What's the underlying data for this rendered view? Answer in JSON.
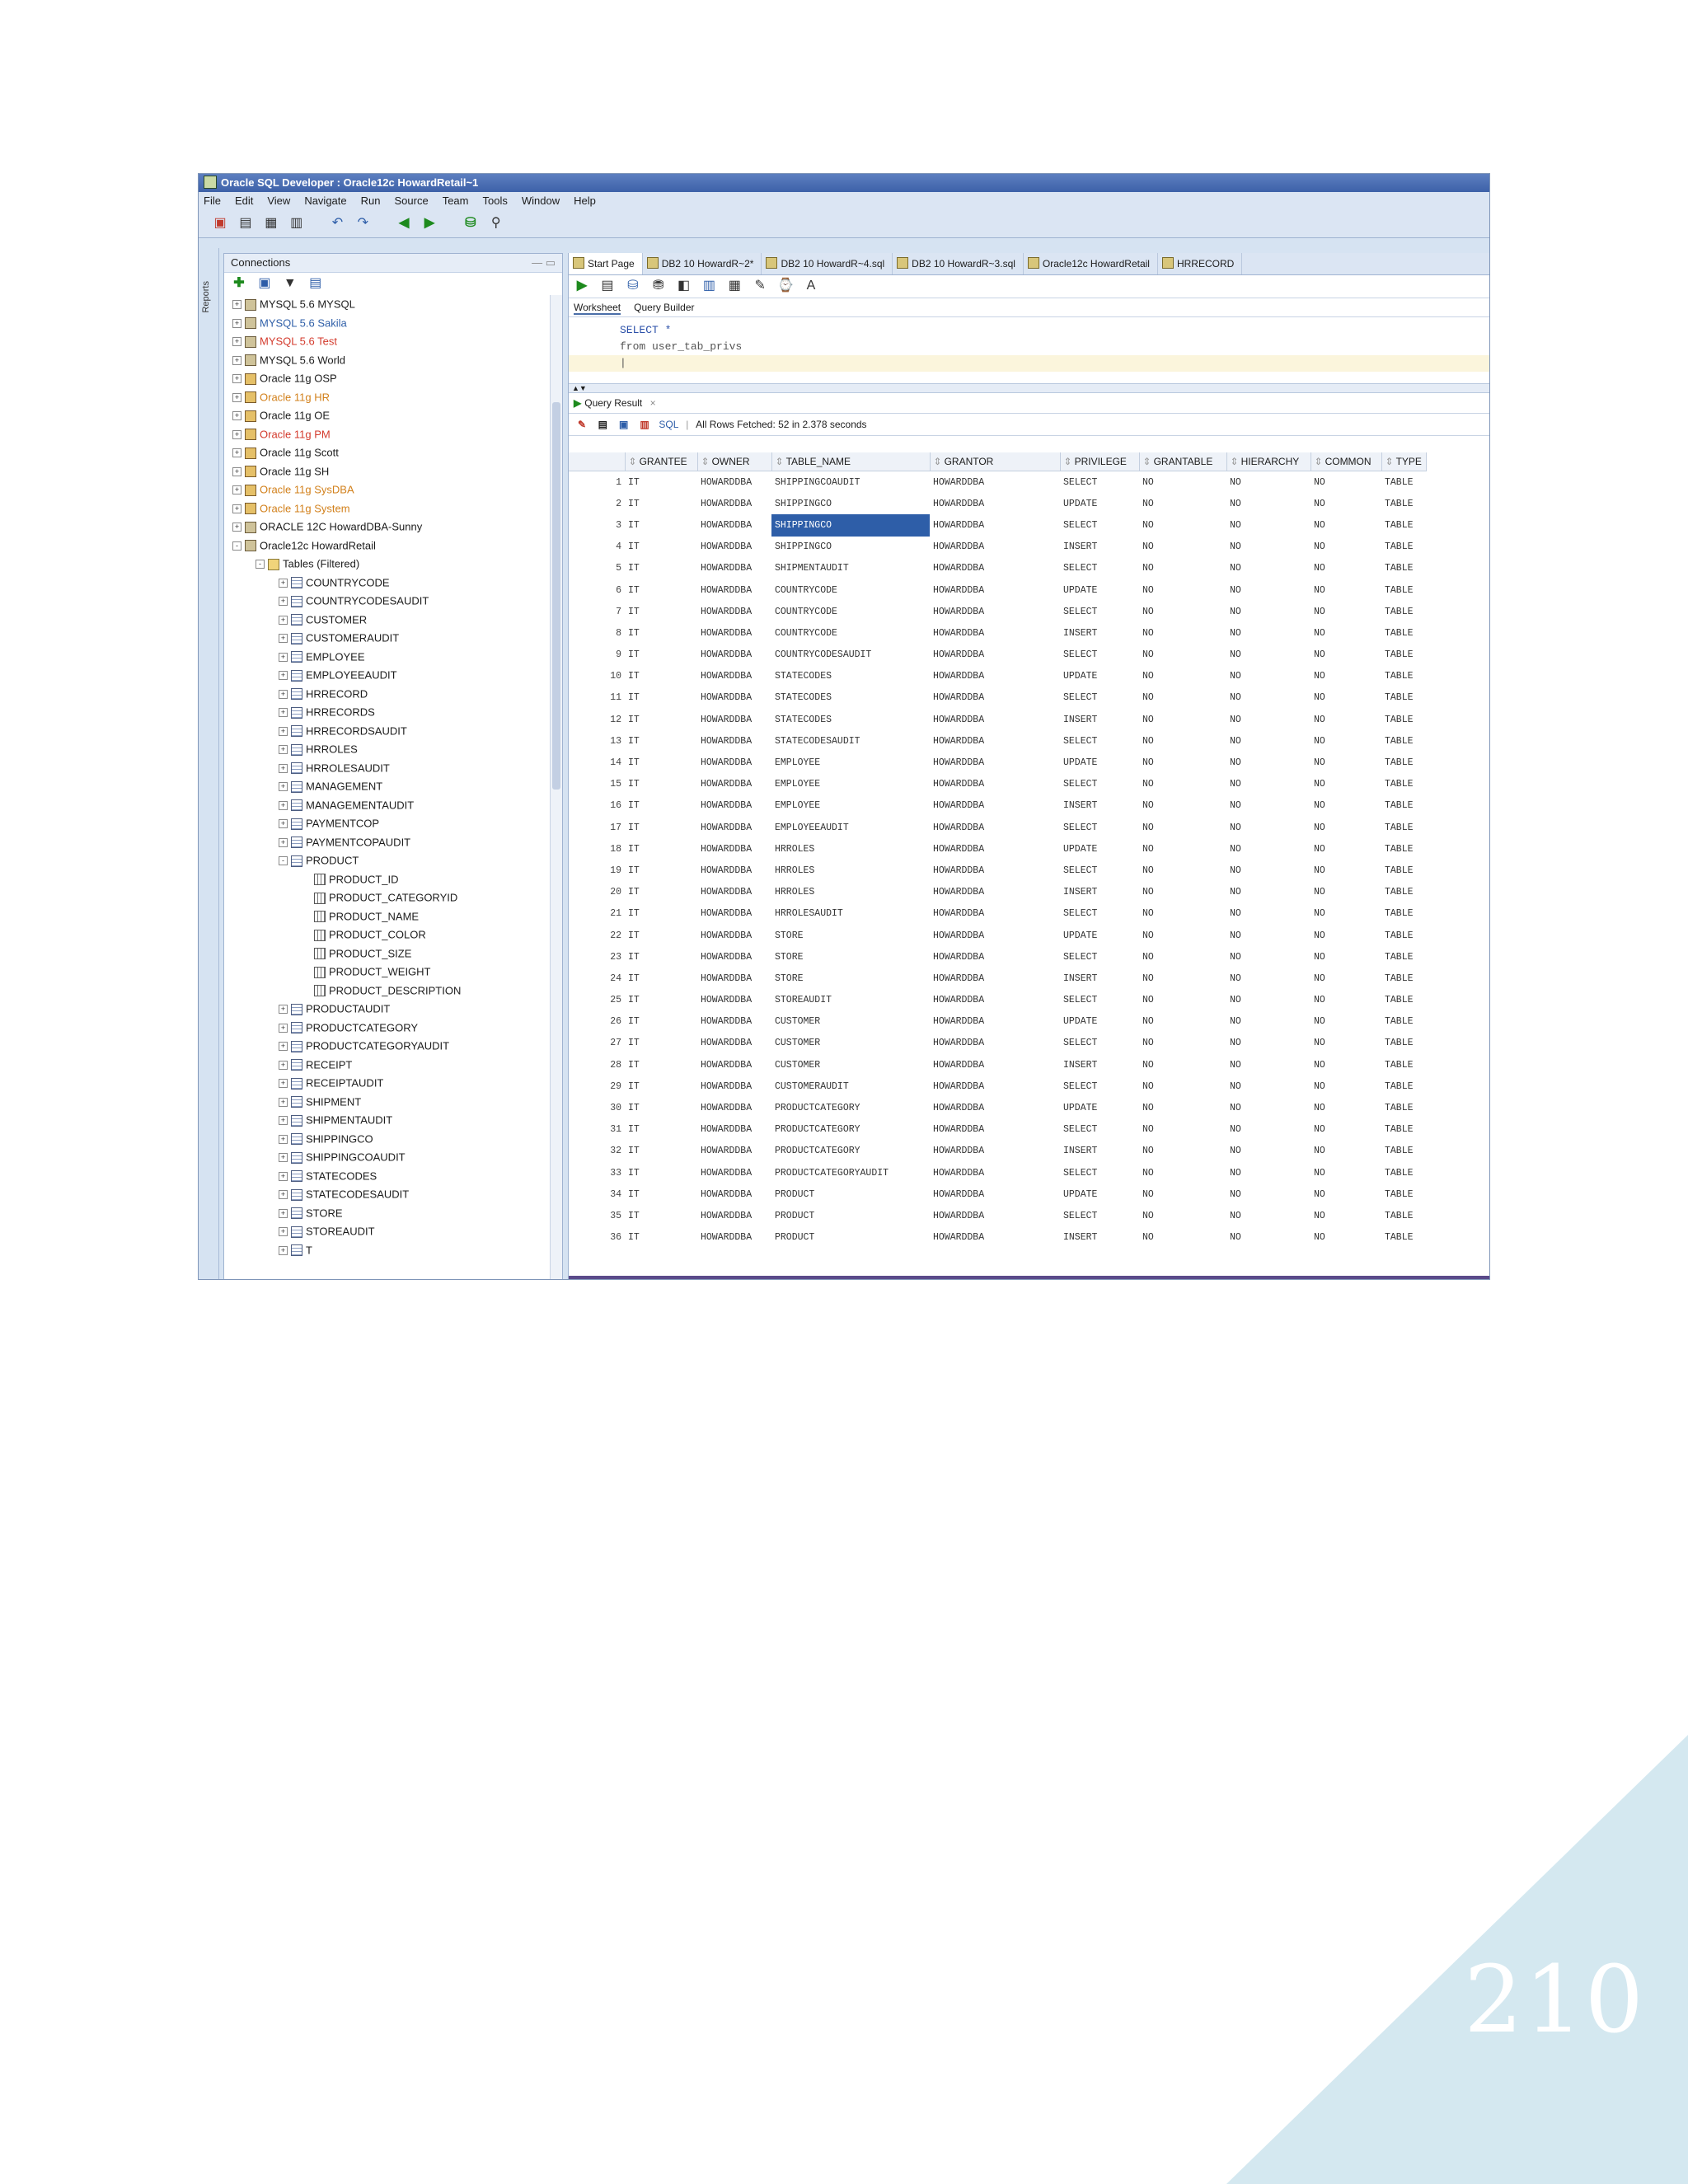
{
  "window": {
    "title": "Oracle SQL Developer : Oracle12c HowardRetail~1"
  },
  "menu": [
    "File",
    "Edit",
    "View",
    "Navigate",
    "Run",
    "Source",
    "Team",
    "Tools",
    "Window",
    "Help"
  ],
  "side_strip": {
    "label": "Reports"
  },
  "connections": {
    "title": "Connections",
    "items": [
      {
        "expander": "+",
        "icon": "conn",
        "label": "MYSQL 5.6 MYSQL",
        "indent": 0,
        "color": ""
      },
      {
        "expander": "+",
        "icon": "conn",
        "label": "MYSQL 5.6 Sakila",
        "indent": 0,
        "color": "blue"
      },
      {
        "expander": "+",
        "icon": "conn",
        "label": "MYSQL 5.6 Test",
        "indent": 0,
        "color": "red"
      },
      {
        "expander": "+",
        "icon": "conn",
        "label": "MYSQL 5.6 World",
        "indent": 0,
        "color": ""
      },
      {
        "expander": "+",
        "icon": "oconn",
        "label": "Oracle 11g OSP",
        "indent": 0,
        "color": ""
      },
      {
        "expander": "+",
        "icon": "oconn",
        "label": "Oracle 11g HR",
        "indent": 0,
        "color": "orange"
      },
      {
        "expander": "+",
        "icon": "oconn",
        "label": "Oracle 11g OE",
        "indent": 0,
        "color": ""
      },
      {
        "expander": "+",
        "icon": "oconn",
        "label": "Oracle 11g PM",
        "indent": 0,
        "color": "red"
      },
      {
        "expander": "+",
        "icon": "oconn",
        "label": "Oracle 11g Scott",
        "indent": 0,
        "color": ""
      },
      {
        "expander": "+",
        "icon": "oconn",
        "label": "Oracle 11g SH",
        "indent": 0,
        "color": ""
      },
      {
        "expander": "+",
        "icon": "oconn",
        "label": "Oracle 11g SysDBA",
        "indent": 0,
        "color": "orange"
      },
      {
        "expander": "+",
        "icon": "oconn",
        "label": "Oracle 11g System",
        "indent": 0,
        "color": "orange"
      },
      {
        "expander": "+",
        "icon": "conn",
        "label": "ORACLE 12C HowardDBA-Sunny",
        "indent": 0,
        "color": ""
      },
      {
        "expander": "-",
        "icon": "conn",
        "label": "Oracle12c HowardRetail",
        "indent": 0,
        "color": ""
      },
      {
        "expander": "-",
        "icon": "folder",
        "label": "Tables (Filtered)",
        "indent": 1,
        "color": ""
      },
      {
        "expander": "+",
        "icon": "table",
        "label": "COUNTRYCODE",
        "indent": 2,
        "color": ""
      },
      {
        "expander": "+",
        "icon": "table",
        "label": "COUNTRYCODESAUDIT",
        "indent": 2,
        "color": ""
      },
      {
        "expander": "+",
        "icon": "table",
        "label": "CUSTOMER",
        "indent": 2,
        "color": ""
      },
      {
        "expander": "+",
        "icon": "table",
        "label": "CUSTOMERAUDIT",
        "indent": 2,
        "color": ""
      },
      {
        "expander": "+",
        "icon": "table",
        "label": "EMPLOYEE",
        "indent": 2,
        "color": ""
      },
      {
        "expander": "+",
        "icon": "table",
        "label": "EMPLOYEEAUDIT",
        "indent": 2,
        "color": ""
      },
      {
        "expander": "+",
        "icon": "table",
        "label": "HRRECORD",
        "indent": 2,
        "color": ""
      },
      {
        "expander": "+",
        "icon": "table",
        "label": "HRRECORDS",
        "indent": 2,
        "color": ""
      },
      {
        "expander": "+",
        "icon": "table",
        "label": "HRRECORDSAUDIT",
        "indent": 2,
        "color": ""
      },
      {
        "expander": "+",
        "icon": "table",
        "label": "HRROLES",
        "indent": 2,
        "color": ""
      },
      {
        "expander": "+",
        "icon": "table",
        "label": "HRROLESAUDIT",
        "indent": 2,
        "color": ""
      },
      {
        "expander": "+",
        "icon": "table",
        "label": "MANAGEMENT",
        "indent": 2,
        "color": ""
      },
      {
        "expander": "+",
        "icon": "table",
        "label": "MANAGEMENTAUDIT",
        "indent": 2,
        "color": ""
      },
      {
        "expander": "+",
        "icon": "table",
        "label": "PAYMENTCOP",
        "indent": 2,
        "color": ""
      },
      {
        "expander": "+",
        "icon": "table",
        "label": "PAYMENTCOPAUDIT",
        "indent": 2,
        "color": ""
      },
      {
        "expander": "-",
        "icon": "table",
        "label": "PRODUCT",
        "indent": 2,
        "color": ""
      },
      {
        "expander": "",
        "icon": "column",
        "label": "PRODUCT_ID",
        "indent": 3,
        "color": ""
      },
      {
        "expander": "",
        "icon": "column",
        "label": "PRODUCT_CATEGORYID",
        "indent": 3,
        "color": ""
      },
      {
        "expander": "",
        "icon": "column",
        "label": "PRODUCT_NAME",
        "indent": 3,
        "color": ""
      },
      {
        "expander": "",
        "icon": "column",
        "label": "PRODUCT_COLOR",
        "indent": 3,
        "color": ""
      },
      {
        "expander": "",
        "icon": "column",
        "label": "PRODUCT_SIZE",
        "indent": 3,
        "color": ""
      },
      {
        "expander": "",
        "icon": "column",
        "label": "PRODUCT_WEIGHT",
        "indent": 3,
        "color": ""
      },
      {
        "expander": "",
        "icon": "column",
        "label": "PRODUCT_DESCRIPTION",
        "indent": 3,
        "color": ""
      },
      {
        "expander": "+",
        "icon": "table",
        "label": "PRODUCTAUDIT",
        "indent": 2,
        "color": ""
      },
      {
        "expander": "+",
        "icon": "table",
        "label": "PRODUCTCATEGORY",
        "indent": 2,
        "color": ""
      },
      {
        "expander": "+",
        "icon": "table",
        "label": "PRODUCTCATEGORYAUDIT",
        "indent": 2,
        "color": ""
      },
      {
        "expander": "+",
        "icon": "table",
        "label": "RECEIPT",
        "indent": 2,
        "color": ""
      },
      {
        "expander": "+",
        "icon": "table",
        "label": "RECEIPTAUDIT",
        "indent": 2,
        "color": ""
      },
      {
        "expander": "+",
        "icon": "table",
        "label": "SHIPMENT",
        "indent": 2,
        "color": ""
      },
      {
        "expander": "+",
        "icon": "table",
        "label": "SHIPMENTAUDIT",
        "indent": 2,
        "color": ""
      },
      {
        "expander": "+",
        "icon": "table",
        "label": "SHIPPINGCO",
        "indent": 2,
        "color": ""
      },
      {
        "expander": "+",
        "icon": "table",
        "label": "SHIPPINGCOAUDIT",
        "indent": 2,
        "color": ""
      },
      {
        "expander": "+",
        "icon": "table",
        "label": "STATECODES",
        "indent": 2,
        "color": ""
      },
      {
        "expander": "+",
        "icon": "table",
        "label": "STATECODESAUDIT",
        "indent": 2,
        "color": ""
      },
      {
        "expander": "+",
        "icon": "table",
        "label": "STORE",
        "indent": 2,
        "color": ""
      },
      {
        "expander": "+",
        "icon": "table",
        "label": "STOREAUDIT",
        "indent": 2,
        "color": ""
      },
      {
        "expander": "+",
        "icon": "table",
        "label": "T",
        "indent": 2,
        "color": ""
      }
    ]
  },
  "doc_tabs": [
    "Start Page",
    "DB2 10 HowardR~2*",
    "DB2 10 HowardR~4.sql",
    "DB2 10 HowardR~3.sql",
    "Oracle12c HowardRetail",
    "HRRECORD"
  ],
  "sub_tabs": [
    "Worksheet",
    "Query Builder"
  ],
  "sql": [
    "SELECT *",
    "from user_tab_privs"
  ],
  "result": {
    "tab_label": "Query Result",
    "tab_close": "×",
    "sql_label": "SQL",
    "status": "All Rows Fetched: 52 in 2.378 seconds"
  },
  "grid": {
    "columns": [
      "GRANTEE",
      "OWNER",
      "TABLE_NAME",
      "GRANTOR",
      "PRIVILEGE",
      "GRANTABLE",
      "HIERARCHY",
      "COMMON",
      "TYPE"
    ],
    "rows": [
      [
        "1",
        "IT",
        "HOWARDDBA",
        "SHIPPINGCOAUDIT",
        "HOWARDDBA",
        "SELECT",
        "NO",
        "NO",
        "NO",
        "TABLE"
      ],
      [
        "2",
        "IT",
        "HOWARDDBA",
        "SHIPPINGCO",
        "HOWARDDBA",
        "UPDATE",
        "NO",
        "NO",
        "NO",
        "TABLE"
      ],
      [
        "3",
        "IT",
        "HOWARDDBA",
        "SHIPPINGCO",
        "HOWARDDBA",
        "SELECT",
        "NO",
        "NO",
        "NO",
        "TABLE"
      ],
      [
        "4",
        "IT",
        "HOWARDDBA",
        "SHIPPINGCO",
        "HOWARDDBA",
        "INSERT",
        "NO",
        "NO",
        "NO",
        "TABLE"
      ],
      [
        "5",
        "IT",
        "HOWARDDBA",
        "SHIPMENTAUDIT",
        "HOWARDDBA",
        "SELECT",
        "NO",
        "NO",
        "NO",
        "TABLE"
      ],
      [
        "6",
        "IT",
        "HOWARDDBA",
        "COUNTRYCODE",
        "HOWARDDBA",
        "UPDATE",
        "NO",
        "NO",
        "NO",
        "TABLE"
      ],
      [
        "7",
        "IT",
        "HOWARDDBA",
        "COUNTRYCODE",
        "HOWARDDBA",
        "SELECT",
        "NO",
        "NO",
        "NO",
        "TABLE"
      ],
      [
        "8",
        "IT",
        "HOWARDDBA",
        "COUNTRYCODE",
        "HOWARDDBA",
        "INSERT",
        "NO",
        "NO",
        "NO",
        "TABLE"
      ],
      [
        "9",
        "IT",
        "HOWARDDBA",
        "COUNTRYCODESAUDIT",
        "HOWARDDBA",
        "SELECT",
        "NO",
        "NO",
        "NO",
        "TABLE"
      ],
      [
        "10",
        "IT",
        "HOWARDDBA",
        "STATECODES",
        "HOWARDDBA",
        "UPDATE",
        "NO",
        "NO",
        "NO",
        "TABLE"
      ],
      [
        "11",
        "IT",
        "HOWARDDBA",
        "STATECODES",
        "HOWARDDBA",
        "SELECT",
        "NO",
        "NO",
        "NO",
        "TABLE"
      ],
      [
        "12",
        "IT",
        "HOWARDDBA",
        "STATECODES",
        "HOWARDDBA",
        "INSERT",
        "NO",
        "NO",
        "NO",
        "TABLE"
      ],
      [
        "13",
        "IT",
        "HOWARDDBA",
        "STATECODESAUDIT",
        "HOWARDDBA",
        "SELECT",
        "NO",
        "NO",
        "NO",
        "TABLE"
      ],
      [
        "14",
        "IT",
        "HOWARDDBA",
        "EMPLOYEE",
        "HOWARDDBA",
        "UPDATE",
        "NO",
        "NO",
        "NO",
        "TABLE"
      ],
      [
        "15",
        "IT",
        "HOWARDDBA",
        "EMPLOYEE",
        "HOWARDDBA",
        "SELECT",
        "NO",
        "NO",
        "NO",
        "TABLE"
      ],
      [
        "16",
        "IT",
        "HOWARDDBA",
        "EMPLOYEE",
        "HOWARDDBA",
        "INSERT",
        "NO",
        "NO",
        "NO",
        "TABLE"
      ],
      [
        "17",
        "IT",
        "HOWARDDBA",
        "EMPLOYEEAUDIT",
        "HOWARDDBA",
        "SELECT",
        "NO",
        "NO",
        "NO",
        "TABLE"
      ],
      [
        "18",
        "IT",
        "HOWARDDBA",
        "HRROLES",
        "HOWARDDBA",
        "UPDATE",
        "NO",
        "NO",
        "NO",
        "TABLE"
      ],
      [
        "19",
        "IT",
        "HOWARDDBA",
        "HRROLES",
        "HOWARDDBA",
        "SELECT",
        "NO",
        "NO",
        "NO",
        "TABLE"
      ],
      [
        "20",
        "IT",
        "HOWARDDBA",
        "HRROLES",
        "HOWARDDBA",
        "INSERT",
        "NO",
        "NO",
        "NO",
        "TABLE"
      ],
      [
        "21",
        "IT",
        "HOWARDDBA",
        "HRROLESAUDIT",
        "HOWARDDBA",
        "SELECT",
        "NO",
        "NO",
        "NO",
        "TABLE"
      ],
      [
        "22",
        "IT",
        "HOWARDDBA",
        "STORE",
        "HOWARDDBA",
        "UPDATE",
        "NO",
        "NO",
        "NO",
        "TABLE"
      ],
      [
        "23",
        "IT",
        "HOWARDDBA",
        "STORE",
        "HOWARDDBA",
        "SELECT",
        "NO",
        "NO",
        "NO",
        "TABLE"
      ],
      [
        "24",
        "IT",
        "HOWARDDBA",
        "STORE",
        "HOWARDDBA",
        "INSERT",
        "NO",
        "NO",
        "NO",
        "TABLE"
      ],
      [
        "25",
        "IT",
        "HOWARDDBA",
        "STOREAUDIT",
        "HOWARDDBA",
        "SELECT",
        "NO",
        "NO",
        "NO",
        "TABLE"
      ],
      [
        "26",
        "IT",
        "HOWARDDBA",
        "CUSTOMER",
        "HOWARDDBA",
        "UPDATE",
        "NO",
        "NO",
        "NO",
        "TABLE"
      ],
      [
        "27",
        "IT",
        "HOWARDDBA",
        "CUSTOMER",
        "HOWARDDBA",
        "SELECT",
        "NO",
        "NO",
        "NO",
        "TABLE"
      ],
      [
        "28",
        "IT",
        "HOWARDDBA",
        "CUSTOMER",
        "HOWARDDBA",
        "INSERT",
        "NO",
        "NO",
        "NO",
        "TABLE"
      ],
      [
        "29",
        "IT",
        "HOWARDDBA",
        "CUSTOMERAUDIT",
        "HOWARDDBA",
        "SELECT",
        "NO",
        "NO",
        "NO",
        "TABLE"
      ],
      [
        "30",
        "IT",
        "HOWARDDBA",
        "PRODUCTCATEGORY",
        "HOWARDDBA",
        "UPDATE",
        "NO",
        "NO",
        "NO",
        "TABLE"
      ],
      [
        "31",
        "IT",
        "HOWARDDBA",
        "PRODUCTCATEGORY",
        "HOWARDDBA",
        "SELECT",
        "NO",
        "NO",
        "NO",
        "TABLE"
      ],
      [
        "32",
        "IT",
        "HOWARDDBA",
        "PRODUCTCATEGORY",
        "HOWARDDBA",
        "INSERT",
        "NO",
        "NO",
        "NO",
        "TABLE"
      ],
      [
        "33",
        "IT",
        "HOWARDDBA",
        "PRODUCTCATEGORYAUDIT",
        "HOWARDDBA",
        "SELECT",
        "NO",
        "NO",
        "NO",
        "TABLE"
      ],
      [
        "34",
        "IT",
        "HOWARDDBA",
        "PRODUCT",
        "HOWARDDBA",
        "UPDATE",
        "NO",
        "NO",
        "NO",
        "TABLE"
      ],
      [
        "35",
        "IT",
        "HOWARDDBA",
        "PRODUCT",
        "HOWARDDBA",
        "SELECT",
        "NO",
        "NO",
        "NO",
        "TABLE"
      ],
      [
        "36",
        "IT",
        "HOWARDDBA",
        "PRODUCT",
        "HOWARDDBA",
        "INSERT",
        "NO",
        "NO",
        "NO",
        "TABLE"
      ]
    ],
    "selected_row": 3,
    "selected_col": 3
  },
  "page": {
    "number": "210",
    "accent": "#d4e8f0"
  }
}
